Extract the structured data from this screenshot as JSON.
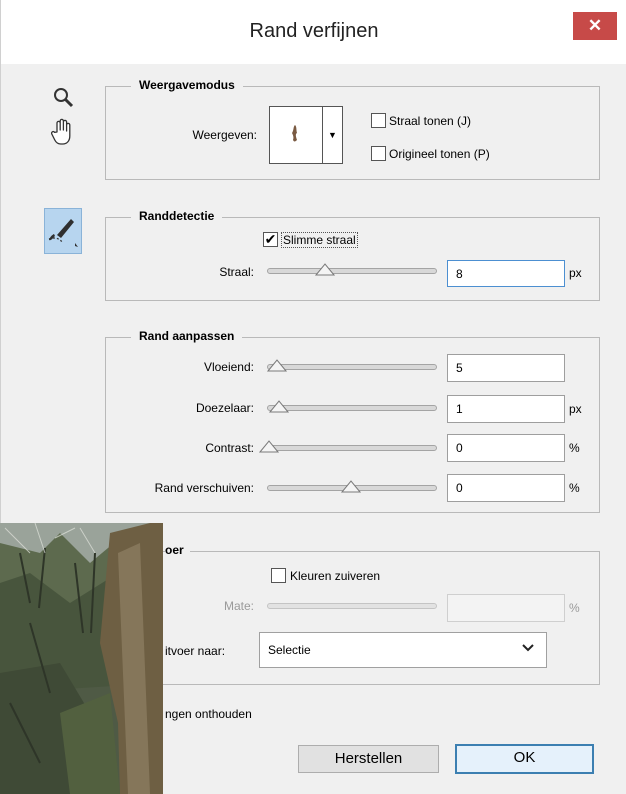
{
  "title": "Rand verfijnen",
  "close_glyph": "✕",
  "tools": {
    "zoom": "zoom-icon",
    "hand": "hand-icon",
    "refine": "refine-radius-brush-icon"
  },
  "display": {
    "legend": "Weergavemodus",
    "view_label": "Weergeven:",
    "show_radius": "Straal tonen (J)",
    "show_original": "Origineel tonen (P)",
    "show_radius_checked": false,
    "show_original_checked": false
  },
  "edge_detection": {
    "legend": "Randdetectie",
    "smart_radius": "Slimme straal",
    "smart_radius_checked": true,
    "radius_label": "Straal:",
    "radius_value": "8",
    "radius_unit": "px",
    "radius_slider": 0.33
  },
  "adjust_edge": {
    "legend": "Rand aanpassen",
    "rows": [
      {
        "label": "Vloeiend:",
        "value": "5",
        "unit": "",
        "slider": 0.0
      },
      {
        "label": "Doezelaar:",
        "value": "1",
        "unit": "px",
        "slider": 0.01
      },
      {
        "label": "Contrast:",
        "value": "0",
        "unit": "%",
        "slider": 0.0
      },
      {
        "label": "Rand verschuiven:",
        "value": "0",
        "unit": "%",
        "slider": 0.5
      }
    ]
  },
  "output": {
    "legend": "Uitvoer",
    "legend_visible": "oer",
    "decontaminate": "Kleuren zuiveren",
    "decontaminate_checked": false,
    "amount_label": "Mate:",
    "amount_value": "",
    "amount_unit": "%",
    "output_to_label": "Uitvoer naar:",
    "output_to_visible": "itvoer naar:",
    "output_to_value": "Selectie"
  },
  "remember": "Instellingen onthouden",
  "remember_visible": "ngen onthouden",
  "buttons": {
    "reset": "Herstellen",
    "ok": "OK"
  }
}
